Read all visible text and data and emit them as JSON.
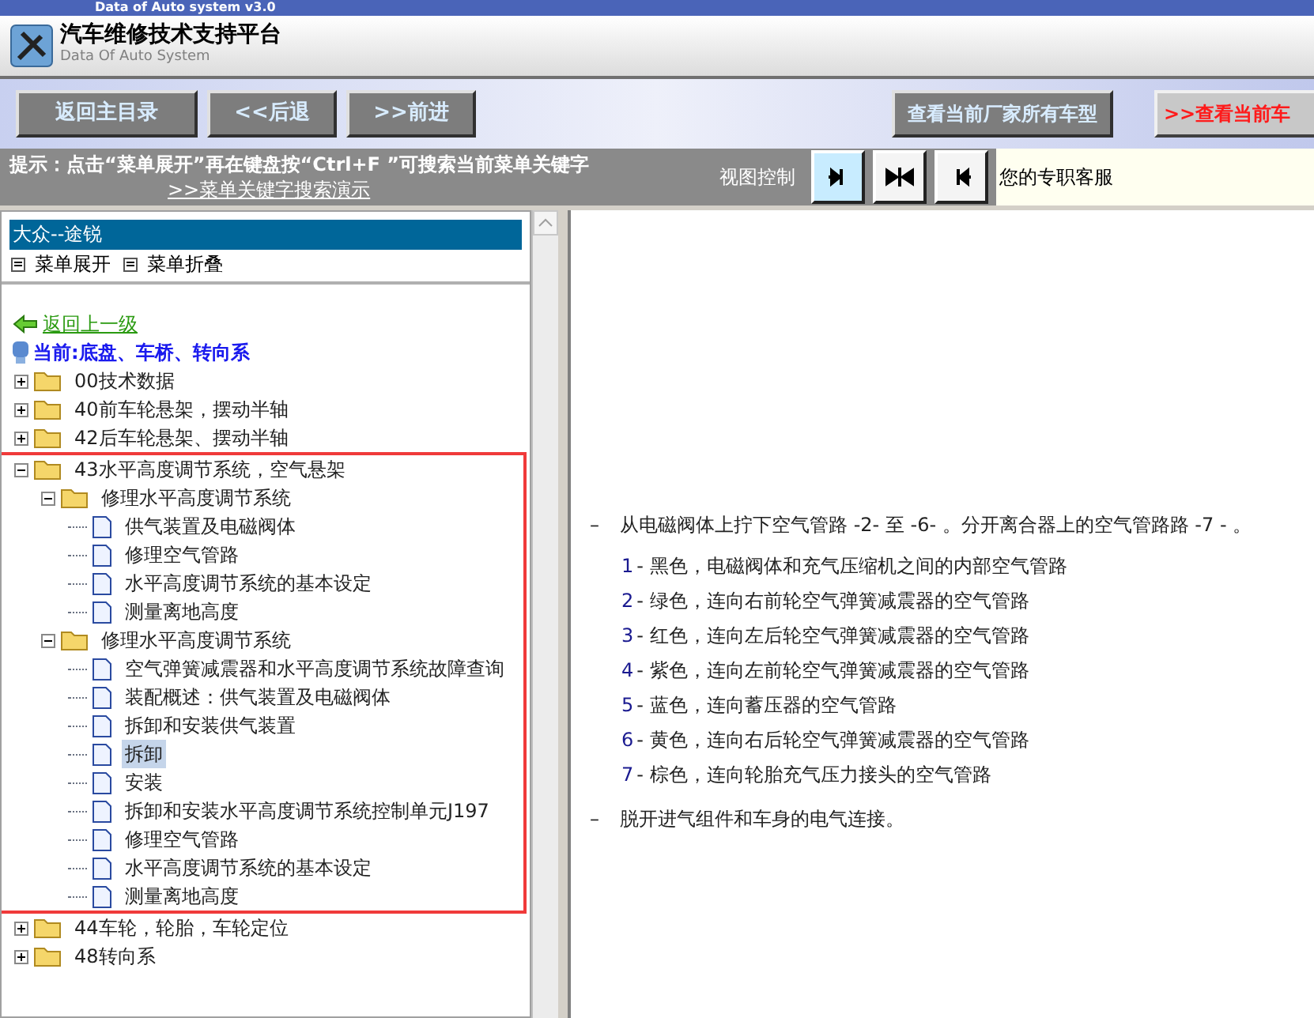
{
  "window": {
    "title": "Data of Auto system v3.0"
  },
  "header": {
    "title": "汽车维修技术支持平台",
    "subtitle": "Data Of Auto System"
  },
  "toolbar": {
    "left_buttons": [
      "返回主目录",
      "<<后退",
      ">>前进"
    ],
    "right_buttons": [
      {
        "label": "查看当前厂家所有车型",
        "kind": "normal"
      },
      {
        "label": ">>查看当前车",
        "kind": "alert"
      }
    ]
  },
  "hint_bar": {
    "hint": "提示：点击“菜单展开”再在键盘按“Ctrl+F ”可搜索当前菜单关键字",
    "link": ">>菜单关键字搜索演示",
    "view_label": "视图控制",
    "view_buttons": [
      {
        "kind": "right",
        "selected": true
      },
      {
        "kind": "both",
        "selected": false
      },
      {
        "kind": "left",
        "selected": false
      }
    ],
    "service": "您的专职客服"
  },
  "sidebar": {
    "title": "大众--途锐",
    "menu_actions": [
      "菜单展开",
      "菜单折叠"
    ],
    "back_link": "返回上一级",
    "current": "当前:底盘、车桥、转向系",
    "tree": [
      {
        "label": "00技术数据",
        "kind": "folder",
        "expanded": false,
        "highlighted": false,
        "selected": false
      },
      {
        "label": "40前车轮悬架，摆动半轴",
        "kind": "folder",
        "expanded": false,
        "highlighted": false,
        "selected": false
      },
      {
        "label": "42后车轮悬架、摆动半轴",
        "kind": "folder",
        "expanded": false,
        "highlighted": false,
        "selected": false
      },
      {
        "label": "43水平高度调节系统，空气悬架",
        "kind": "folder",
        "expanded": true,
        "highlighted": true,
        "selected": false,
        "children": [
          {
            "label": "修理水平高度调节系统",
            "kind": "folder",
            "expanded": true,
            "selected": false,
            "children": [
              {
                "label": "供气装置及电磁阀体",
                "kind": "doc",
                "selected": false
              },
              {
                "label": "修理空气管路",
                "kind": "doc",
                "selected": false
              },
              {
                "label": "水平高度调节系统的基本设定",
                "kind": "doc",
                "selected": false
              },
              {
                "label": "测量离地高度",
                "kind": "doc",
                "selected": false
              }
            ]
          },
          {
            "label": "修理水平高度调节系统",
            "kind": "folder",
            "expanded": true,
            "selected": false,
            "children": [
              {
                "label": "空气弹簧减震器和水平高度调节系统故障查询",
                "kind": "doc",
                "selected": false
              },
              {
                "label": "装配概述：供气装置及电磁阀体",
                "kind": "doc",
                "selected": false
              },
              {
                "label": "拆卸和安装供气装置",
                "kind": "doc",
                "selected": false
              },
              {
                "label": "拆卸",
                "kind": "doc",
                "selected": true
              },
              {
                "label": "安装",
                "kind": "doc",
                "selected": false
              },
              {
                "label": "拆卸和安装水平高度调节系统控制单元J197",
                "kind": "doc",
                "selected": false
              },
              {
                "label": "修理空气管路",
                "kind": "doc",
                "selected": false
              },
              {
                "label": "水平高度调节系统的基本设定",
                "kind": "doc",
                "selected": false
              },
              {
                "label": "测量离地高度",
                "kind": "doc",
                "selected": false
              }
            ]
          }
        ]
      },
      {
        "label": "44车轮，轮胎，车轮定位",
        "kind": "folder",
        "expanded": false,
        "highlighted": false,
        "selected": false
      },
      {
        "label": "48转向系",
        "kind": "folder",
        "expanded": false,
        "highlighted": false,
        "selected": false
      }
    ]
  },
  "content": {
    "steps": [
      {
        "bullet": "–",
        "text": "从电磁阀体上拧下空气管路 -2- 至 -6- 。分开离合器上的空气管路路 -7 - 。",
        "items": [
          {
            "number": "1",
            "text": "- 黑色，电磁阀体和充气压缩机之间的内部空气管路"
          },
          {
            "number": "2",
            "text": "- 绿色，连向右前轮空气弹簧减震器的空气管路"
          },
          {
            "number": "3",
            "text": "- 红色，连向左后轮空气弹簧减震器的空气管路"
          },
          {
            "number": "4",
            "text": "- 紫色，连向左前轮空气弹簧减震器的空气管路"
          },
          {
            "number": "5",
            "text": "- 蓝色，连向蓄压器的空气管路"
          },
          {
            "number": "6",
            "text": "- 黄色，连向右后轮空气弹簧减震器的空气管路"
          },
          {
            "number": "7",
            "text": "- 棕色，连向轮胎充气压力接头的空气管路"
          }
        ]
      },
      {
        "bullet": "–",
        "text": "脱开进气组件和车身的电气连接。"
      }
    ]
  }
}
